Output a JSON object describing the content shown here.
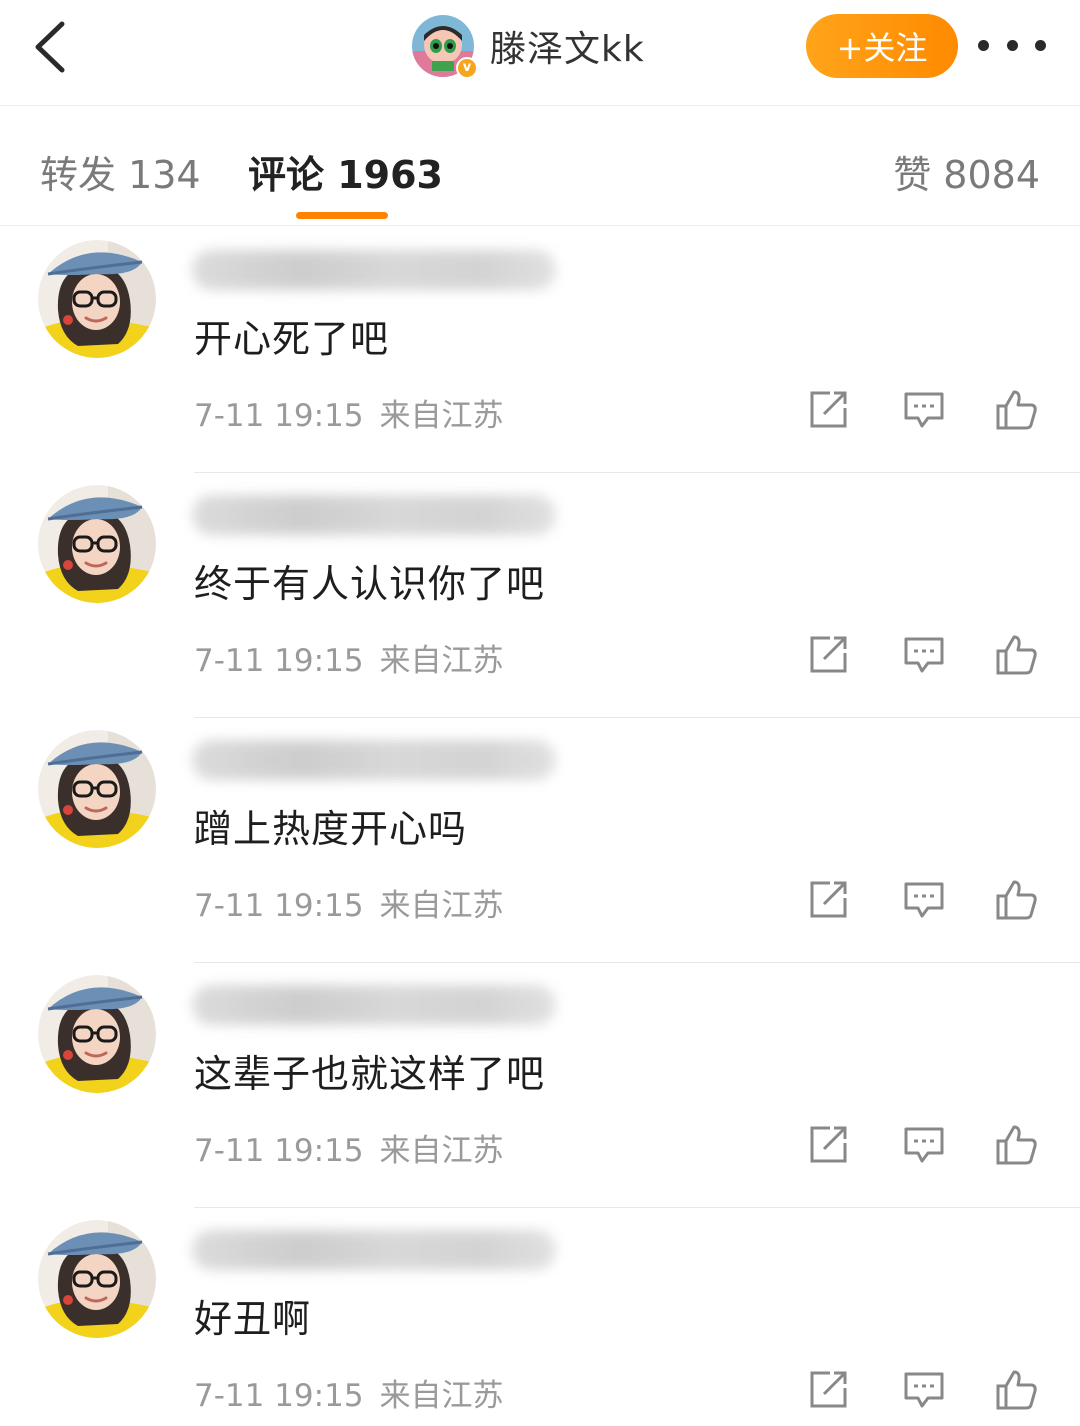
{
  "header": {
    "username": "滕泽文kk",
    "verified": "v",
    "follow_label": "+关注",
    "accent_color": "#ff8a00"
  },
  "tabs": [
    {
      "label": "转发 134",
      "active": false
    },
    {
      "label": "评论 1963",
      "active": true
    },
    {
      "label": "赞 8084",
      "active": false
    }
  ],
  "comments": [
    {
      "text": "开心死了吧",
      "time": "7-11 19:15",
      "location": "来自江苏"
    },
    {
      "text": "终于有人认识你了吧",
      "time": "7-11 19:15",
      "location": "来自江苏"
    },
    {
      "text": "蹭上热度开心吗",
      "time": "7-11 19:15",
      "location": "来自江苏"
    },
    {
      "text": "这辈子也就这样了吧",
      "time": "7-11 19:15",
      "location": "来自江苏"
    },
    {
      "text": "好丑啊",
      "time": "7-11 19:15",
      "location": "来自江苏"
    }
  ],
  "icons": {
    "back": "chevron-left-icon",
    "more": "more-dots-icon",
    "share": "share-icon",
    "reply": "comment-icon",
    "like": "thumbs-up-icon"
  }
}
